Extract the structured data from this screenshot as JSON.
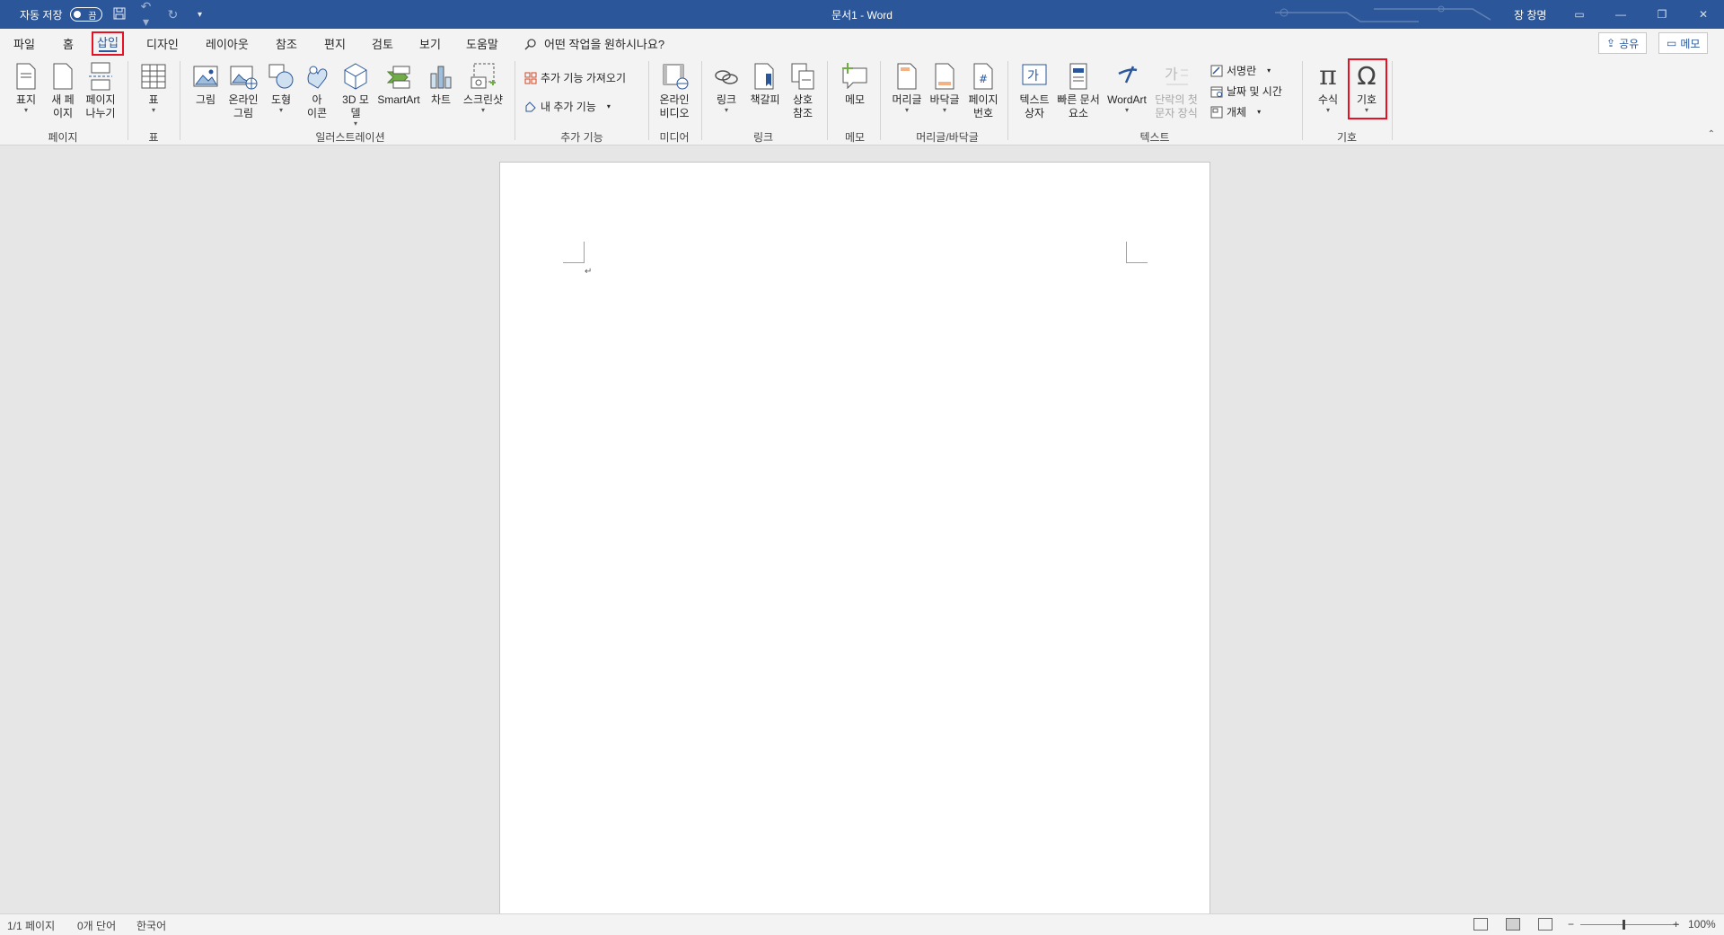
{
  "titlebar": {
    "autosave_label": "자동 저장",
    "autosave_state": "끔",
    "doc_title": "문서1  -  Word",
    "user": "장 창명",
    "icons": [
      "save-icon",
      "undo-icon",
      "redo-icon",
      "customize-quick-access-icon"
    ]
  },
  "tabs": [
    "파일",
    "홈",
    "삽입",
    "디자인",
    "레이아웃",
    "참조",
    "편지",
    "검토",
    "보기",
    "도움말"
  ],
  "active_tab": "삽입",
  "tell_me": "어떤 작업을 원하시나요?",
  "share_label": "공유",
  "memo_label": "메모",
  "ribbon": {
    "pages": [
      "표지",
      "새 페\n이지",
      "페이지\n나누기"
    ],
    "table": "표",
    "illustrations": [
      "그림",
      "온라인\n그림",
      "도형",
      "아\n이콘",
      "3D 모\n델",
      "SmartArt",
      "차트",
      "스크린샷"
    ],
    "addins": [
      "추가 기능 가져오기",
      "내 추가 기능"
    ],
    "media": "온라인\n비디오",
    "links": [
      "링크",
      "책갈피",
      "상호\n참조"
    ],
    "comment": "메모",
    "header_footer": [
      "머리글",
      "바닥글",
      "페이지\n번호"
    ],
    "text": [
      "텍스트\n상자",
      "빠른 문서\n요소",
      "WordArt",
      "단락의 첫\n문자 장식"
    ],
    "text_small": [
      "서명란",
      "날짜 및 시간",
      "개체"
    ],
    "symbols": [
      "수식",
      "기호"
    ],
    "groups": [
      "페이지",
      "표",
      "일러스트레이션",
      "추가 기능",
      "미디어",
      "링크",
      "메모",
      "머리글/바닥글",
      "텍스트",
      "기호"
    ]
  },
  "statusbar": {
    "page": "1/1 페이지",
    "words": "0개 단어",
    "language": "한국어",
    "zoom": "100%"
  },
  "colors": {
    "title_bar": "#2b579a",
    "highlight": "#e81123"
  }
}
